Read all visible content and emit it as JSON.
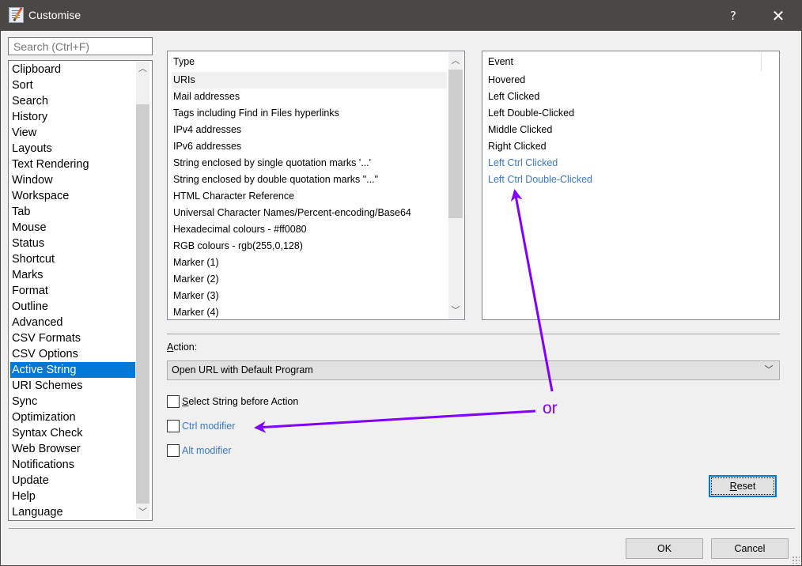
{
  "window": {
    "title": "Customise",
    "help_label": "?",
    "close_label": "✕",
    "app_icon": "notepad-pencil-icon"
  },
  "search": {
    "placeholder": "Search (Ctrl+F)"
  },
  "categories": {
    "items": [
      "Clipboard",
      "Sort",
      "Search",
      "History",
      "View",
      "Layouts",
      "Text Rendering",
      "Window",
      "Workspace",
      "Tab",
      "Mouse",
      "Status",
      "Shortcut",
      "Marks",
      "Format",
      "Outline",
      "Advanced",
      "CSV Formats",
      "CSV Options",
      "Active String",
      "URI Schemes",
      "Sync",
      "Optimization",
      "Syntax Check",
      "Web Browser",
      "Notifications",
      "Update",
      "Help",
      "Language"
    ],
    "selected": "Active String",
    "scroll_up_icon": "chevron-up-icon",
    "scroll_down_icon": "chevron-down-icon"
  },
  "type_list": {
    "header": "Type",
    "rows": [
      "URIs",
      "Mail addresses",
      "Tags including Find in Files hyperlinks",
      "IPv4 addresses",
      "IPv6 addresses",
      "String enclosed by single quotation marks '...'",
      "String enclosed by double quotation marks \"...\"",
      "HTML Character Reference",
      "Universal Character Names/Percent-encoding/Base64",
      "Hexadecimal colours - #ff0080",
      "RGB colours - rgb(255,0,128)",
      "Marker (1)",
      "Marker (2)",
      "Marker (3)",
      "Marker (4)"
    ],
    "selected": "URIs"
  },
  "event_list": {
    "header": "Event",
    "rows": [
      {
        "label": "Hovered",
        "highlight": false
      },
      {
        "label": "Left Clicked",
        "highlight": false
      },
      {
        "label": "Left Double-Clicked",
        "highlight": false
      },
      {
        "label": "Middle Clicked",
        "highlight": false
      },
      {
        "label": "Right Clicked",
        "highlight": false
      },
      {
        "label": "Left Ctrl Clicked",
        "highlight": true
      },
      {
        "label": "Left Ctrl Double-Clicked",
        "highlight": true
      }
    ]
  },
  "action": {
    "label_accel": "A",
    "label_rest": "ction:",
    "value": "Open URL with Default Program",
    "dropdown_icon": "chevron-down-icon"
  },
  "options": {
    "select_string": {
      "accel": "S",
      "rest": "elect String before Action",
      "checked": false
    },
    "ctrl_modifier": {
      "label": "Ctrl modifier",
      "checked": false
    },
    "alt_modifier": {
      "label": "Alt modifier",
      "checked": false
    }
  },
  "buttons": {
    "reset_accel": "R",
    "reset_rest": "eset",
    "ok": "OK",
    "cancel": "Cancel"
  },
  "annotation": {
    "text": "or",
    "color": "#8000ff"
  },
  "colors": {
    "selection": "#0078d7",
    "link": "#3c78c8",
    "titlebar": "#4a4845"
  }
}
